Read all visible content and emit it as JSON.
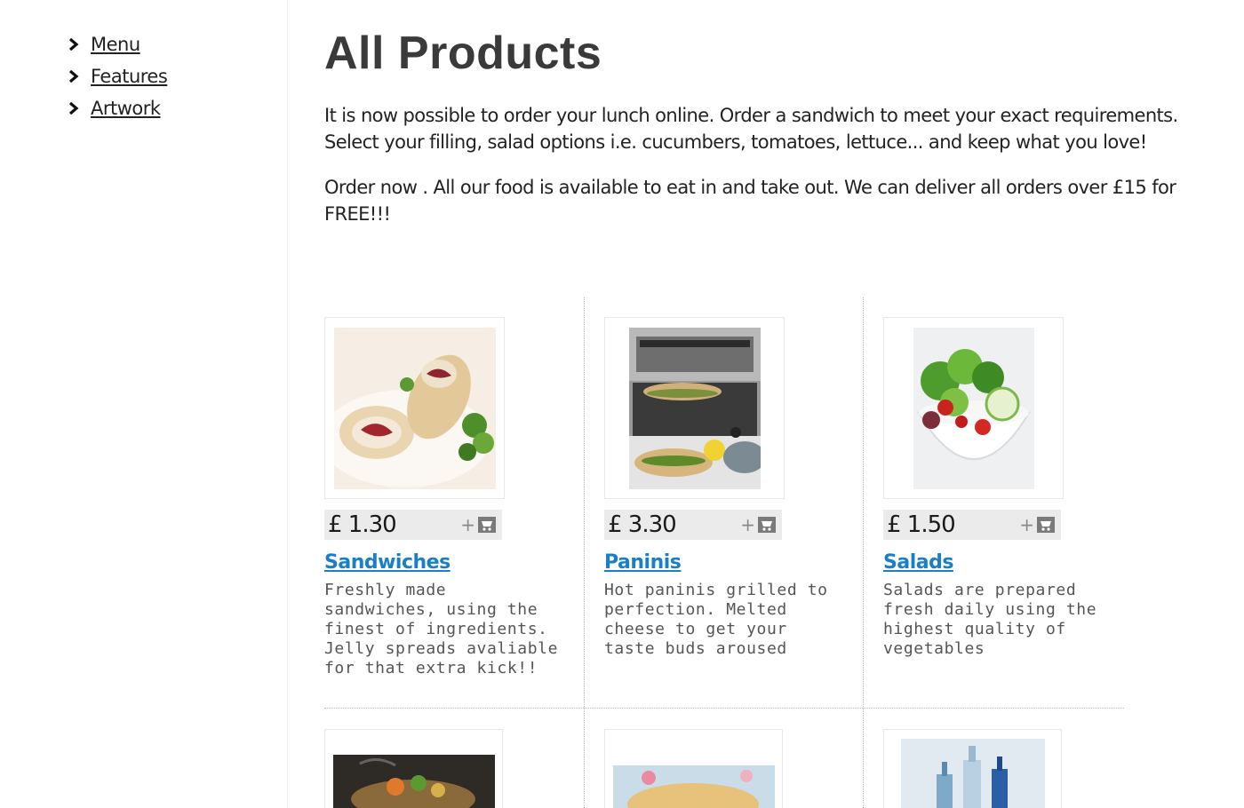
{
  "sidebar": {
    "items": [
      {
        "label": "Menu",
        "icon": "chevron-right-icon"
      },
      {
        "label": "Features",
        "icon": "chevron-right-icon"
      },
      {
        "label": "Artwork",
        "icon": "chevron-right-icon"
      }
    ]
  },
  "main": {
    "title": "All Products",
    "intro": [
      "It is now possible to order your lunch online. Order a sandwich to meet your exact requirements.  Select your filling, salad options i.e. cucumbers, tomatoes, lettuce... and keep what you love!",
      "Order now . All our food is available to eat in and take out.  We can deliver all orders over £15 for FREE!!!"
    ]
  },
  "products": [
    {
      "name": "Sandwiches",
      "price": "£ 1.30",
      "add_icon": "add-to-cart-icon",
      "description": "Freshly made sandwiches, using the finest of ingredients. Jelly spreads avaliable for that extra kick!!"
    },
    {
      "name": "Paninis",
      "price": "£ 3.30",
      "add_icon": "add-to-cart-icon",
      "description": "Hot paninis grilled to perfection. Melted cheese to get your taste buds aroused"
    },
    {
      "name": "Salads",
      "price": "£ 1.50",
      "add_icon": "add-to-cart-icon",
      "description": "Salads are prepared fresh daily using the highest quality of vegetables"
    }
  ],
  "colors": {
    "link": "#1a7fc4",
    "price_bar": "#ebebeb",
    "heading": "#3a3a3a"
  }
}
